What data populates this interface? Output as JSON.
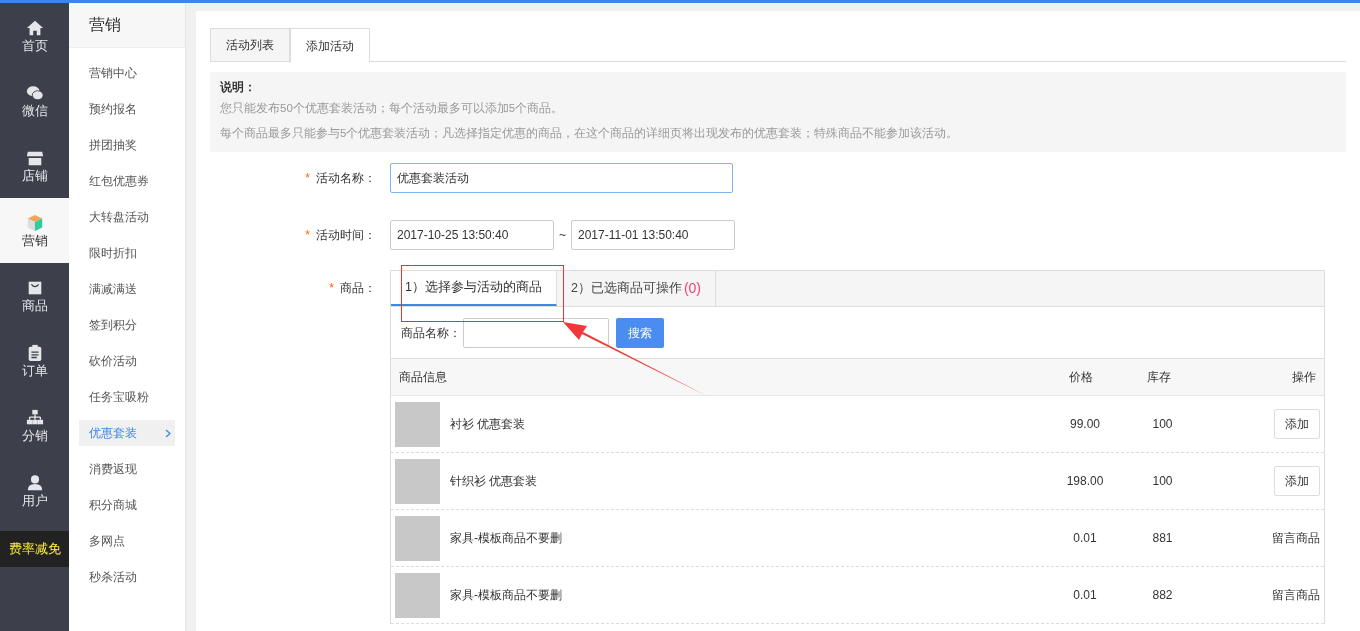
{
  "main_nav": [
    {
      "label": "首页",
      "selected": false,
      "kind": "normal"
    },
    {
      "label": "微信",
      "selected": false,
      "kind": "normal"
    },
    {
      "label": "店铺",
      "selected": false,
      "kind": "normal"
    },
    {
      "label": "营销",
      "selected": true,
      "kind": "normal"
    },
    {
      "label": "商品",
      "selected": false,
      "kind": "normal"
    },
    {
      "label": "订单",
      "selected": false,
      "kind": "normal"
    },
    {
      "label": "分销",
      "selected": false,
      "kind": "normal"
    },
    {
      "label": "用户",
      "selected": false,
      "kind": "normal"
    },
    {
      "label": "费率减免",
      "selected": false,
      "kind": "promo"
    }
  ],
  "sub_nav": {
    "title": "营销",
    "items": [
      {
        "label": "营销中心",
        "selected": false
      },
      {
        "label": "预约报名",
        "selected": false
      },
      {
        "label": "拼团抽奖",
        "selected": false
      },
      {
        "label": "红包优惠券",
        "selected": false
      },
      {
        "label": "大转盘活动",
        "selected": false
      },
      {
        "label": "限时折扣",
        "selected": false
      },
      {
        "label": "满减满送",
        "selected": false
      },
      {
        "label": "签到积分",
        "selected": false
      },
      {
        "label": "砍价活动",
        "selected": false
      },
      {
        "label": "任务宝吸粉",
        "selected": false
      },
      {
        "label": "优惠套装",
        "selected": true
      },
      {
        "label": "消费返现",
        "selected": false
      },
      {
        "label": "积分商城",
        "selected": false
      },
      {
        "label": "多网点",
        "selected": false
      },
      {
        "label": "秒杀活动",
        "selected": false
      }
    ]
  },
  "tabs": [
    {
      "label": "活动列表",
      "selected": false
    },
    {
      "label": "添加活动",
      "selected": true
    }
  ],
  "notice": {
    "title": "说明：",
    "lines": [
      "您只能发布50个优惠套装活动；每个活动最多可以添加5个商品。",
      "每个商品最多只能参与5个优惠套装活动；凡选择指定优惠的商品，在这个商品的详细页将出现发布的优惠套装；特殊商品不能参加该活动。"
    ]
  },
  "form": {
    "name": {
      "required_mark": "*",
      "label": "活动名称：",
      "value": "优惠套装活动"
    },
    "time": {
      "required_mark": "*",
      "label": "活动时间：",
      "start": "2017-10-25 13:50:40",
      "separator": "~",
      "end": "2017-11-01 13:50:40"
    },
    "goods": {
      "required_mark": "*",
      "label": "商品：",
      "tabs": [
        {
          "label": "1）选择参与活动的商品",
          "selected": true
        },
        {
          "label": "2）已选商品可操作",
          "count": "(0)",
          "selected": false
        }
      ],
      "search": {
        "label": "商品名称：",
        "button": "搜索"
      },
      "columns": [
        "商品信息",
        "价格",
        "库存",
        "操作"
      ],
      "rows": [
        {
          "name": "衬衫 优惠套装",
          "price": "99.00",
          "stock": "100",
          "action": {
            "kind": "button",
            "label": "添加"
          }
        },
        {
          "name": "针织衫 优惠套装",
          "price": "198.00",
          "stock": "100",
          "action": {
            "kind": "button",
            "label": "添加"
          }
        },
        {
          "name": "家具-模板商品不要删",
          "price": "0.01",
          "stock": "881",
          "action": {
            "kind": "text",
            "label": "留言商品"
          }
        },
        {
          "name": "家具-模板商品不要删",
          "price": "0.01",
          "stock": "882",
          "action": {
            "kind": "text",
            "label": "留言商品"
          }
        }
      ]
    }
  }
}
